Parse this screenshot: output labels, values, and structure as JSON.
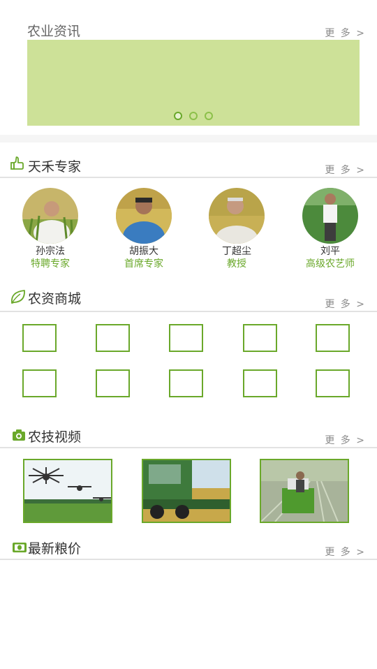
{
  "news": {
    "title": "农业资讯",
    "more": "更 多 >",
    "carousel_pages": 3,
    "carousel_active": 0
  },
  "experts": {
    "title": "天禾专家",
    "more": "更 多 >",
    "items": [
      {
        "name": "孙宗法",
        "title": "特聘专家"
      },
      {
        "name": "胡振大",
        "title": "首席专家"
      },
      {
        "name": "丁超尘",
        "title": "教授"
      },
      {
        "name": "刘平",
        "title": "高级农艺师"
      }
    ]
  },
  "mall": {
    "title": "农资商城",
    "more": "更 多 >",
    "product_slots": 10
  },
  "videos": {
    "title": "农技视频",
    "more": "更 多 >",
    "items": [
      {
        "subject": "drones-spraying"
      },
      {
        "subject": "combine-harvester"
      },
      {
        "subject": "rice-transplanter"
      }
    ]
  },
  "prices": {
    "title": "最新粮价",
    "more": "更 多 >"
  },
  "colors": {
    "accent": "#6aa82a",
    "banner": "#cde198"
  },
  "icons": {
    "experts": "thumb-icon",
    "mall": "leaf-icon",
    "videos": "camera-icon",
    "prices": "money-icon"
  }
}
